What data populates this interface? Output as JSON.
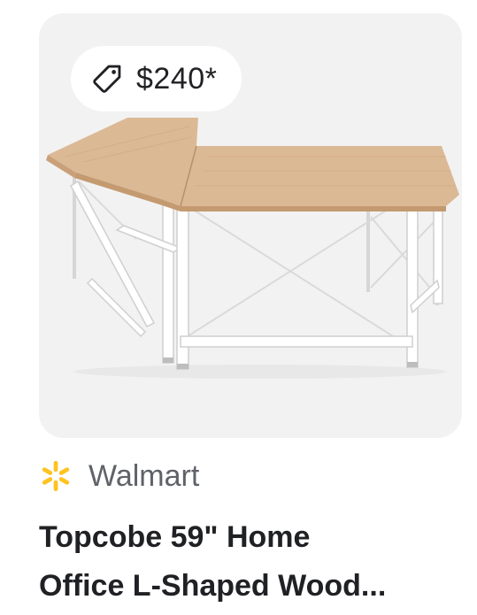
{
  "product_card": {
    "price": "$240*",
    "merchant": "Walmart",
    "title_line_1": "Topcobe 59\" Home",
    "title_line_2": "Office L-Shaped Wood..."
  },
  "icons": {
    "price_tag": "tag-icon",
    "merchant_logo": "walmart-spark-icon"
  },
  "colors": {
    "card_background": "#f2f2f2",
    "chip_background": "#ffffff",
    "walmart_spark": "#ffc220",
    "text_primary": "#202124",
    "text_secondary": "#5f6368",
    "desk_top": "#dcb995"
  }
}
